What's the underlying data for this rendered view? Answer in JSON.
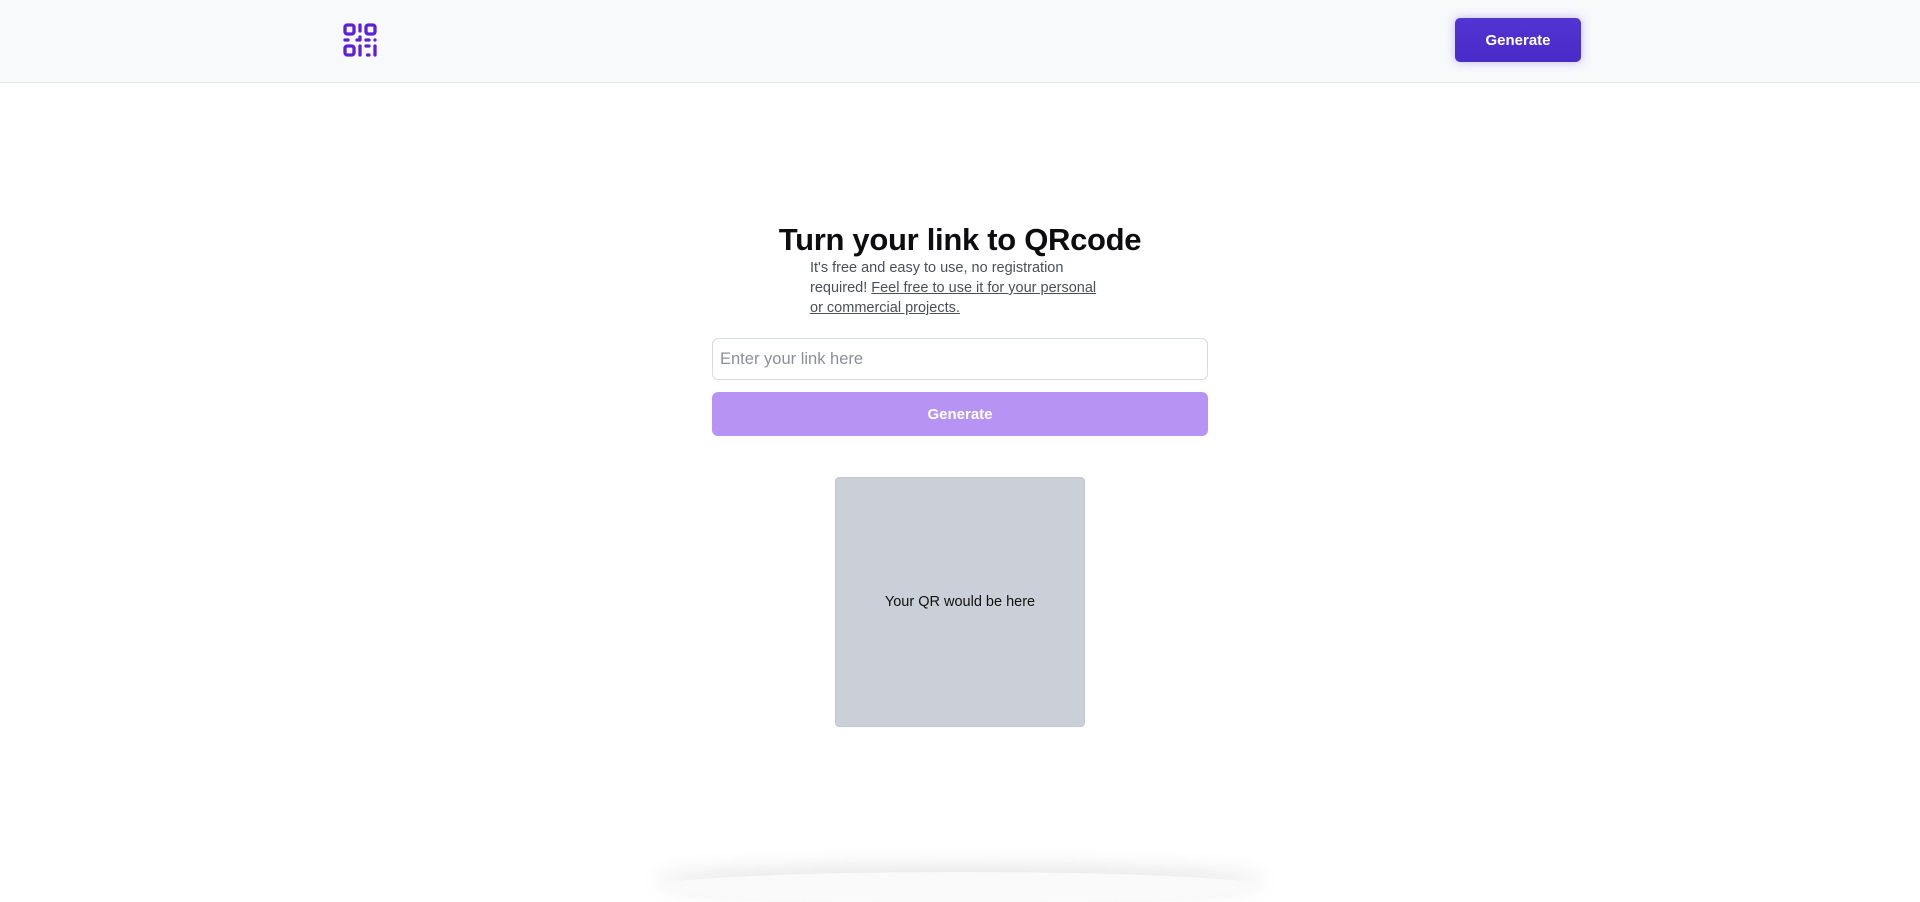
{
  "header": {
    "logo_icon": "qr-code-icon",
    "generate_label": "Generate",
    "accent_color": "#4f2fd0"
  },
  "main": {
    "title": "Turn your link to QRcode",
    "subtitle_text": "It's free and easy to use, no registration required!",
    "subtitle_link": "Feel free to use it for your personal or commercial projects.",
    "input": {
      "placeholder": "Enter your link here",
      "value": ""
    },
    "generate_label": "Generate",
    "generate_color": "#b794f4",
    "qr_placeholder_text": "Your QR would be here"
  }
}
